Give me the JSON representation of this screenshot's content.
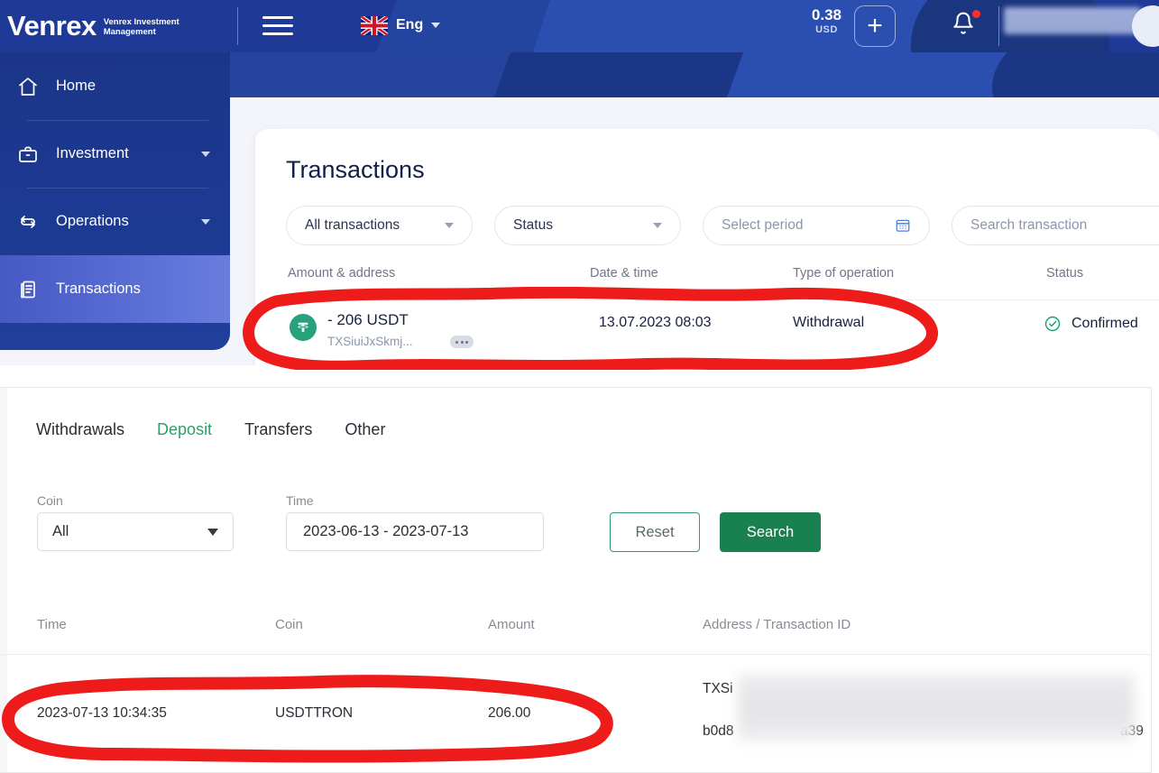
{
  "app": {
    "header": {
      "brand_name": "Venrex",
      "brand_tagline_line1": "Venrex Investment",
      "brand_tagline_line2": "Management",
      "menu_icon": "hamburger-icon",
      "language": "Eng",
      "flag_icon": "uk-flag-icon",
      "balance_amount": "0.38",
      "balance_currency": "USD",
      "add_button_label": "+",
      "notification_icon": "bell-icon",
      "user_name_redacted": ""
    },
    "sidebar": {
      "items": [
        {
          "label": "Home",
          "icon": "home-icon",
          "has_chevron": false,
          "active": false
        },
        {
          "label": "Investment",
          "icon": "briefcase-icon",
          "has_chevron": true,
          "active": false
        },
        {
          "label": "Operations",
          "icon": "exchange-arrows-icon",
          "has_chevron": true,
          "active": false
        },
        {
          "label": "Transactions",
          "icon": "document-list-icon",
          "has_chevron": false,
          "active": true
        }
      ]
    },
    "main": {
      "title": "Transactions",
      "filters": {
        "type_filter": "All transactions",
        "status_filter": "Status",
        "period_placeholder": "Select period",
        "period_icon": "calendar-icon",
        "search_placeholder": "Search transaction"
      },
      "table": {
        "headers": [
          "Amount & address",
          "Date & time",
          "Type of operation",
          "Status"
        ],
        "rows": [
          {
            "coin_icon": "tether-usdt-icon",
            "amount": "- 206 USDT",
            "address": "TXSiuiJxSkmj...",
            "more_icon": "ellipsis-badge-icon",
            "date": "13.07.2023 08:03",
            "type": "Withdrawal",
            "status": "Confirmed",
            "status_icon": "check-circle-icon"
          }
        ]
      }
    }
  },
  "exchange": {
    "tabs": [
      {
        "label": "Withdrawals",
        "active": false
      },
      {
        "label": "Deposit",
        "active": true
      },
      {
        "label": "Transfers",
        "active": false
      },
      {
        "label": "Other",
        "active": false
      }
    ],
    "filters": {
      "coin_label": "Coin",
      "coin_value": "All",
      "time_label": "Time",
      "time_value": "2023-06-13 - 2023-07-13",
      "reset_label": "Reset",
      "search_label": "Search"
    },
    "table": {
      "headers": [
        "Time",
        "Coin",
        "Amount",
        "Address / Transaction ID"
      ],
      "rows": [
        {
          "time": "2023-07-13 10:34:35",
          "coin": "USDTTRON",
          "amount": "206.00",
          "address_prefix": "TXSi",
          "txid_prefix": "b0d8",
          "txid_suffix": "a39"
        }
      ]
    }
  },
  "annotations": {
    "highlight_color": "#ee1b1b",
    "marks": [
      {
        "name": "red-circle-transaction-row",
        "target": "top transaction row"
      },
      {
        "name": "red-circle-history-row",
        "target": "bottom history row"
      }
    ]
  },
  "colors": {
    "brand_blue": "#1e3a96",
    "sidebar_active": "#5b6ed6",
    "accent_green": "#19814f",
    "tether_green": "#26a17b",
    "annotation_red": "#ee1b1b"
  }
}
